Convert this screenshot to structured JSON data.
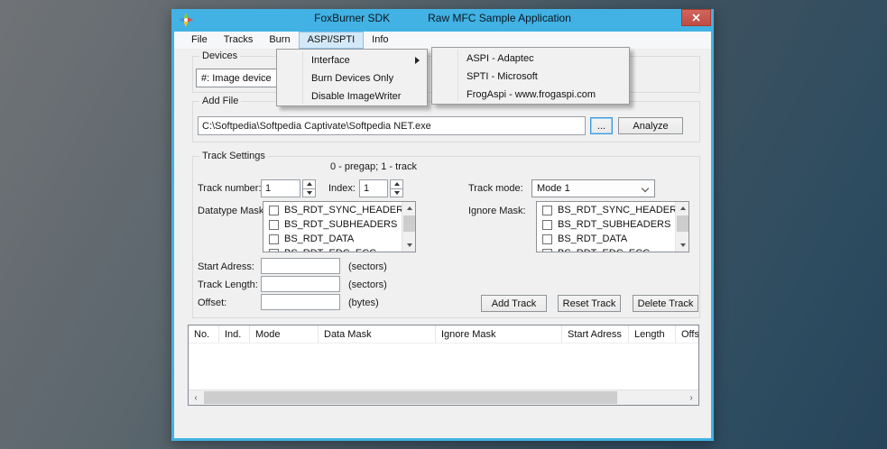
{
  "window": {
    "title_left": "FoxBurner SDK",
    "title_right": "Raw MFC Sample Application"
  },
  "colors": {
    "titlebar": "#41b2e3",
    "close_button": "#c4504a",
    "menu_highlight": "#d4e9f8",
    "client_bg": "#f0f0f0"
  },
  "menu_bar": {
    "items": [
      "File",
      "Tracks",
      "Burn",
      "ASPI/SPTI",
      "Info"
    ],
    "selected": "ASPI/SPTI"
  },
  "menu_popup": {
    "interface_label": "Interface",
    "burn_devices_only_label": "Burn Devices Only",
    "disable_imagewriter_label": "Disable ImageWriter"
  },
  "interface_submenu": {
    "aspi_label": "ASPI - Adaptec",
    "spti_label": "SPTI - Microsoft",
    "frogaspi_label": "FrogAspi - www.frogaspi.com"
  },
  "devices": {
    "group_label": "Devices",
    "device_value": "#: Image device"
  },
  "add_file": {
    "group_label": "Add File",
    "file_path": "C:\\Softpedia\\Softpedia Captivate\\Softpedia NET.exe",
    "browse_label": "...",
    "analyze_label": "Analyze"
  },
  "track_settings": {
    "group_label": "Track Settings",
    "hint": "0 - pregap; 1 - track",
    "track_number_label": "Track number:",
    "track_number_value": "1",
    "index_label": "Index:",
    "index_value": "1",
    "track_mode_label": "Track mode:",
    "track_mode_value": "Mode 1",
    "datatype_mask_label": "Datatype Mask:",
    "ignore_mask_label": "Ignore Mask:",
    "mask_items": [
      "BS_RDT_SYNC_HEADER",
      "BS_RDT_SUBHEADERS",
      "BS_RDT_DATA",
      "BS_RDT_EDC_ECC"
    ],
    "start_adress_label": "Start Adress:",
    "start_adress_value": "",
    "start_adress_unit": "(sectors)",
    "track_length_label": "Track Length:",
    "track_length_value": "",
    "track_length_unit": "(sectors)",
    "offset_label": "Offset:",
    "offset_value": "",
    "offset_unit": "(bytes)",
    "add_track_label": "Add Track",
    "reset_track_label": "Reset Track",
    "delete_track_label": "Delete Track"
  },
  "track_table": {
    "columns": [
      "No.",
      "Ind.",
      "Mode",
      "Data Mask",
      "Ignore Mask",
      "Start Adress",
      "Length",
      "Offset"
    ],
    "rows": []
  }
}
